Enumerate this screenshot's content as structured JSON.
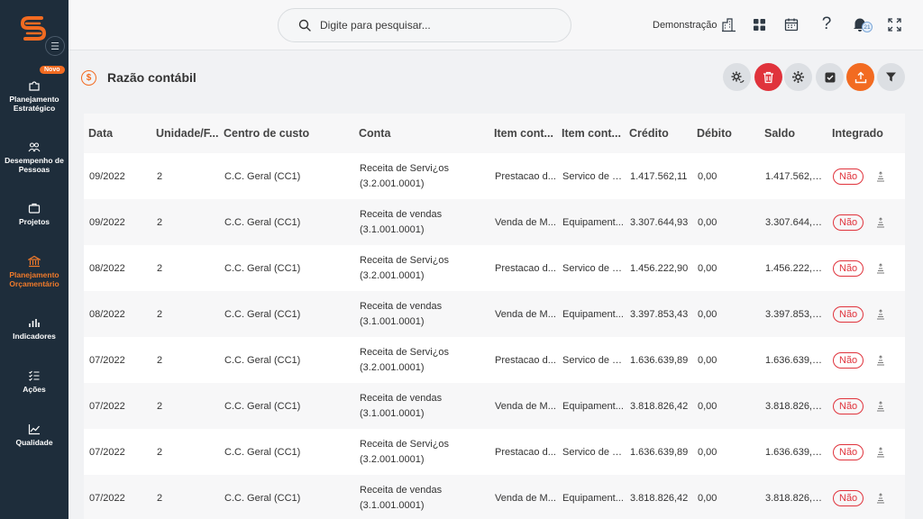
{
  "colors": {
    "sidebar": "#1e2d3b",
    "accent": "#f26b21",
    "danger": "#e0333c",
    "gray_btn": "#dcdfe3"
  },
  "sidebar": {
    "new_badge": "Novo",
    "items": [
      {
        "label": "Planejamento Estratégico",
        "icon": "puzzle-icon"
      },
      {
        "label": "Desempenho de Pessoas",
        "icon": "people-icon"
      },
      {
        "label": "Projetos",
        "icon": "briefcase-icon"
      },
      {
        "label": "Planejamento Orçamentário",
        "icon": "bank-icon",
        "active": true
      },
      {
        "label": "Indicadores",
        "icon": "bar-chart-icon"
      },
      {
        "label": "Ações",
        "icon": "checklist-icon"
      },
      {
        "label": "Qualidade",
        "icon": "trend-icon"
      }
    ]
  },
  "topbar": {
    "search_placeholder": "Digite para pesquisar...",
    "company": "Demonstração",
    "notification_count": "21"
  },
  "page": {
    "title": "Razão contábil"
  },
  "table": {
    "columns": [
      "Data",
      "Unidade/F...",
      "Centro de custo",
      "Conta",
      "Item cont...",
      "Item cont...",
      "Crédito",
      "Débito",
      "Saldo",
      "Integrado"
    ],
    "rows": [
      {
        "data": "09/2022",
        "unidade": "2",
        "centro": "C.C. Geral (CC1)",
        "conta": "Receita de Servi¿os (3.2.001.0001)",
        "item1": "Prestacao d...",
        "item2": "Servico de C...",
        "credito": "1.417.562,11",
        "debito": "0,00",
        "saldo": "1.417.562,11",
        "integrado": "Não"
      },
      {
        "data": "09/2022",
        "unidade": "2",
        "centro": "C.C. Geral (CC1)",
        "conta": "Receita de vendas (3.1.001.0001)",
        "item1": "Venda de M...",
        "item2": "Equipament...",
        "credito": "3.307.644,93",
        "debito": "0,00",
        "saldo": "3.307.644,93",
        "integrado": "Não"
      },
      {
        "data": "08/2022",
        "unidade": "2",
        "centro": "C.C. Geral (CC1)",
        "conta": "Receita de Servi¿os (3.2.001.0001)",
        "item1": "Prestacao d...",
        "item2": "Servico de C...",
        "credito": "1.456.222,90",
        "debito": "0,00",
        "saldo": "1.456.222,90",
        "integrado": "Não"
      },
      {
        "data": "08/2022",
        "unidade": "2",
        "centro": "C.C. Geral (CC1)",
        "conta": "Receita de vendas (3.1.001.0001)",
        "item1": "Venda de M...",
        "item2": "Equipament...",
        "credito": "3.397.853,43",
        "debito": "0,00",
        "saldo": "3.397.853,43",
        "integrado": "Não"
      },
      {
        "data": "07/2022",
        "unidade": "2",
        "centro": "C.C. Geral (CC1)",
        "conta": "Receita de Servi¿os (3.2.001.0001)",
        "item1": "Prestacao d...",
        "item2": "Servico de C...",
        "credito": "1.636.639,89",
        "debito": "0,00",
        "saldo": "1.636.639,89",
        "integrado": "Não"
      },
      {
        "data": "07/2022",
        "unidade": "2",
        "centro": "C.C. Geral (CC1)",
        "conta": "Receita de vendas (3.1.001.0001)",
        "item1": "Venda de M...",
        "item2": "Equipament...",
        "credito": "3.818.826,42",
        "debito": "0,00",
        "saldo": "3.818.826,42",
        "integrado": "Não"
      },
      {
        "data": "07/2022",
        "unidade": "2",
        "centro": "C.C. Geral (CC1)",
        "conta": "Receita de Servi¿os (3.2.001.0001)",
        "item1": "Prestacao d...",
        "item2": "Servico de C...",
        "credito": "1.636.639,89",
        "debito": "0,00",
        "saldo": "1.636.639,89",
        "integrado": "Não"
      },
      {
        "data": "07/2022",
        "unidade": "2",
        "centro": "C.C. Geral (CC1)",
        "conta": "Receita de vendas (3.1.001.0001)",
        "item1": "Venda de M...",
        "item2": "Equipament...",
        "credito": "3.818.826,42",
        "debito": "0,00",
        "saldo": "3.818.826,42",
        "integrado": "Não"
      }
    ]
  }
}
